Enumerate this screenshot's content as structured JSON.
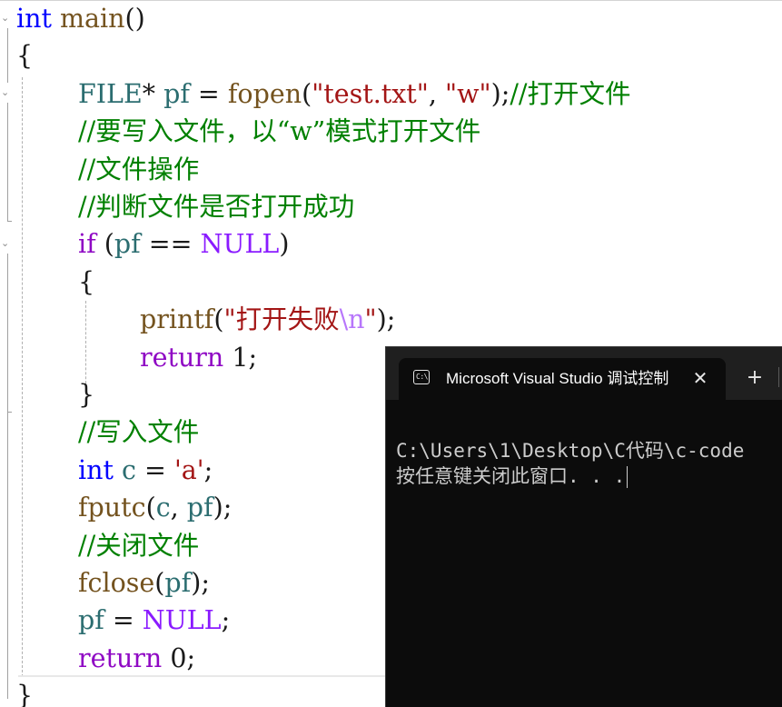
{
  "editor": {
    "lines": [
      [
        {
          "t": "int",
          "c": "kw"
        },
        {
          "t": " ",
          "c": "plain"
        },
        {
          "t": "main",
          "c": "fn"
        },
        {
          "t": "()",
          "c": "plain"
        }
      ],
      [
        {
          "t": "{",
          "c": "plain"
        }
      ],
      [
        {
          "t": "FILE",
          "c": "type-teal"
        },
        {
          "t": "* ",
          "c": "plain"
        },
        {
          "t": "pf",
          "c": "type-teal"
        },
        {
          "t": " = ",
          "c": "plain"
        },
        {
          "t": "fopen",
          "c": "fn"
        },
        {
          "t": "(",
          "c": "plain"
        },
        {
          "t": "\"test.txt\"",
          "c": "str"
        },
        {
          "t": ", ",
          "c": "plain"
        },
        {
          "t": "\"w\"",
          "c": "str"
        },
        {
          "t": ");",
          "c": "plain"
        },
        {
          "t": "//打开文件",
          "c": "cmt"
        }
      ],
      [
        {
          "t": "//要写入文件，以“w”模式打开文件",
          "c": "cmt"
        }
      ],
      [
        {
          "t": "//文件操作",
          "c": "cmt"
        }
      ],
      [
        {
          "t": "//判断文件是否打开成功",
          "c": "cmt"
        }
      ],
      [
        {
          "t": "if",
          "c": "kw-purple"
        },
        {
          "t": " (",
          "c": "plain"
        },
        {
          "t": "pf",
          "c": "type-teal"
        },
        {
          "t": " == ",
          "c": "plain"
        },
        {
          "t": "NULL",
          "c": "macro"
        },
        {
          "t": ")",
          "c": "plain"
        }
      ],
      [
        {
          "t": "{",
          "c": "plain"
        }
      ],
      [
        {
          "t": "printf",
          "c": "fn"
        },
        {
          "t": "(",
          "c": "plain"
        },
        {
          "t": "\"打开失败",
          "c": "str"
        },
        {
          "t": "\\n",
          "c": "esc"
        },
        {
          "t": "\"",
          "c": "str"
        },
        {
          "t": ");",
          "c": "plain"
        }
      ],
      [
        {
          "t": "return",
          "c": "kw-purple"
        },
        {
          "t": " 1;",
          "c": "plain"
        }
      ],
      [
        {
          "t": "}",
          "c": "plain"
        }
      ],
      [
        {
          "t": "//写入文件",
          "c": "cmt"
        }
      ],
      [
        {
          "t": "int",
          "c": "kw"
        },
        {
          "t": " ",
          "c": "plain"
        },
        {
          "t": "c",
          "c": "type-teal"
        },
        {
          "t": " = ",
          "c": "plain"
        },
        {
          "t": "'a'",
          "c": "str"
        },
        {
          "t": ";",
          "c": "plain"
        }
      ],
      [
        {
          "t": "fputc",
          "c": "fn"
        },
        {
          "t": "(",
          "c": "plain"
        },
        {
          "t": "c",
          "c": "type-teal"
        },
        {
          "t": ", ",
          "c": "plain"
        },
        {
          "t": "pf",
          "c": "type-teal"
        },
        {
          "t": ");",
          "c": "plain"
        }
      ],
      [
        {
          "t": "//关闭文件",
          "c": "cmt"
        }
      ],
      [
        {
          "t": "fclose",
          "c": "fn"
        },
        {
          "t": "(",
          "c": "plain"
        },
        {
          "t": "pf",
          "c": "type-teal"
        },
        {
          "t": ");",
          "c": "plain"
        }
      ],
      [
        {
          "t": "pf",
          "c": "type-teal"
        },
        {
          "t": " = ",
          "c": "plain"
        },
        {
          "t": "NULL",
          "c": "macro"
        },
        {
          "t": ";",
          "c": "plain"
        }
      ],
      [
        {
          "t": "return",
          "c": "kw-purple"
        },
        {
          "t": " 0;",
          "c": "plain"
        }
      ],
      [
        {
          "t": "}",
          "c": "plain"
        }
      ]
    ]
  },
  "console": {
    "tab_title": "Microsoft Visual Studio 调试控制台",
    "tab_icon_glyph": "C:\\",
    "close_glyph": "✕",
    "new_tab_glyph": "+",
    "output": [
      "C:\\Users\\1\\Desktop\\C代码\\c-code",
      "按任意键关闭此窗口. . ."
    ]
  },
  "colors": {
    "keyword_blue": "#0000ff",
    "keyword_purple": "#8f08c4",
    "identifier_teal": "#2b6d70",
    "function_brown": "#74531f",
    "string_red": "#a31515",
    "comment_green": "#008000",
    "macro_violet": "#8a1bff",
    "console_bg": "#0c0c0c",
    "console_titlebar": "#1f1f1f"
  }
}
